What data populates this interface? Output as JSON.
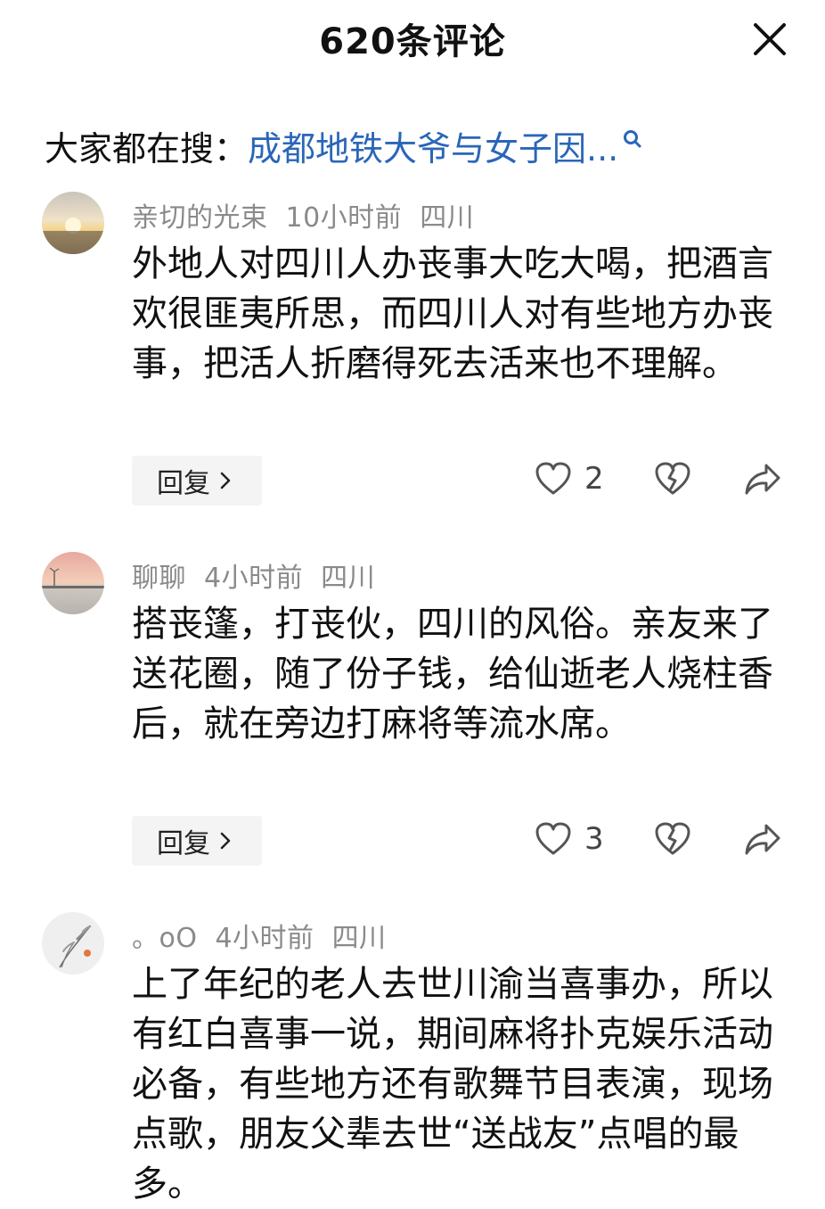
{
  "header": {
    "title": "620条评论",
    "close_icon": "close-icon"
  },
  "search": {
    "prefix": "大家都在搜：",
    "query": "成都地铁大爷与女子因...",
    "icon": "search-icon",
    "link_color": "#2a66b8"
  },
  "comments": [
    {
      "username": "亲切的光束",
      "time": "10小时前",
      "location": "四川",
      "text": "外地人对四川人办丧事大吃大喝，把酒言欢很匪夷所思，而四川人对有些地方办丧事，把活人折磨得死去活来也不理解。",
      "reply_label": "回复",
      "likes": "2"
    },
    {
      "username": "聊聊",
      "time": "4小时前",
      "location": "四川",
      "text": "搭丧篷，打丧伙，四川的风俗。亲友来了送花圈，随了份子钱，给仙逝老人烧柱香后，就在旁边打麻将等流水席。",
      "reply_label": "回复",
      "likes": "3"
    },
    {
      "username": "。oO",
      "time": "4小时前",
      "location": "四川",
      "text": "上了年纪的老人去世川渝当喜事办，所以有红白喜事一说，期间麻将扑克娱乐活动必备，有些地方还有歌舞节目表演，现场点歌，朋友父辈去世“送战友”点唱的最多。"
    }
  ],
  "colors": {
    "meta_text": "#8a8a8a",
    "reply_bg": "#f4f4f4",
    "icon_stroke": "#555555"
  }
}
